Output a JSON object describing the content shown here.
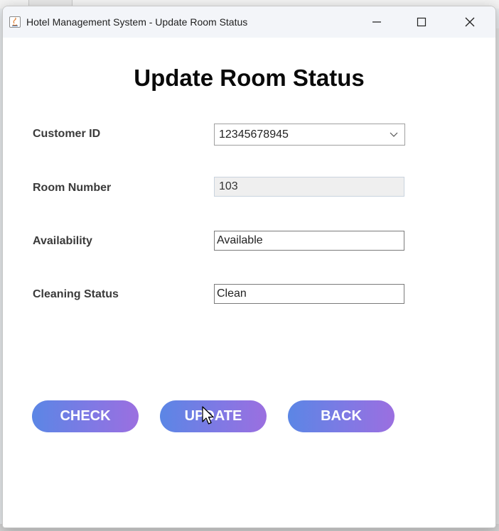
{
  "window": {
    "title": "Hotel Management System - Update Room Status",
    "icon": "java-app-icon",
    "controls": [
      "minimize-icon",
      "maximize-icon",
      "close-icon"
    ]
  },
  "form": {
    "heading": "Update Room Status",
    "customer_id": {
      "label": "Customer ID",
      "value": "12345678945"
    },
    "room_number": {
      "label": "Room Number",
      "value": "103"
    },
    "availability": {
      "label": "Availability",
      "value": "Available"
    },
    "cleaning_status": {
      "label": "Cleaning Status",
      "value": "Clean"
    }
  },
  "buttons": {
    "check": "CHECK",
    "update": "UPDATE",
    "back": "BACK"
  },
  "colors": {
    "button_gradient_start": "#5b86e5",
    "button_gradient_end": "#9b6fe0",
    "title_bar": "#f3f5f9"
  }
}
